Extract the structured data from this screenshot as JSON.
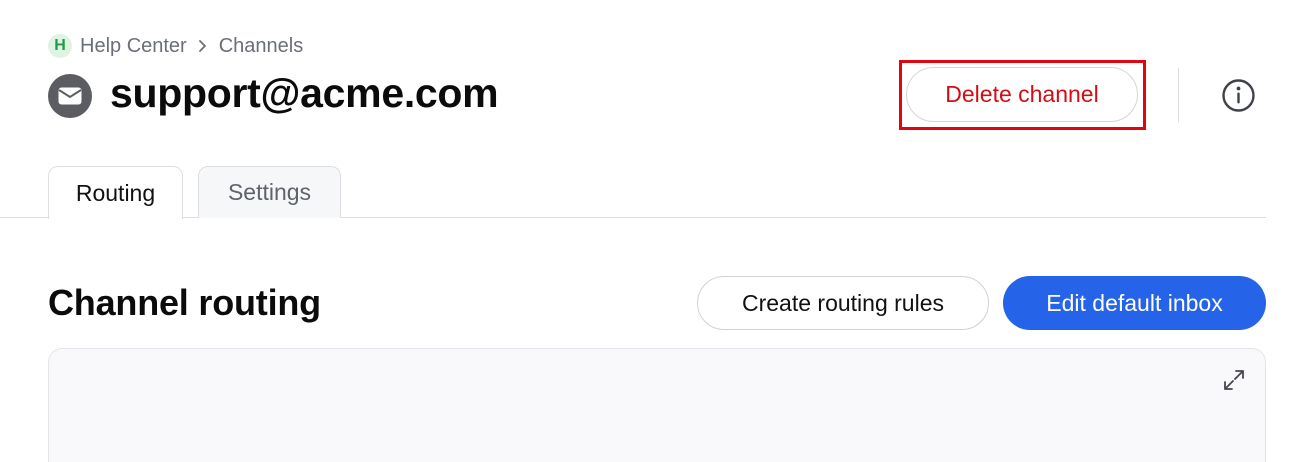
{
  "breadcrumb": {
    "logo_letter": "H",
    "items": [
      "Help Center",
      "Channels"
    ]
  },
  "header": {
    "title": "support@acme.com",
    "avatar_icon": "envelope-icon",
    "delete_label": "Delete channel",
    "info_icon": "info-icon"
  },
  "tabs": [
    {
      "label": "Routing",
      "active": true
    },
    {
      "label": "Settings",
      "active": false
    }
  ],
  "section": {
    "title": "Channel routing",
    "create_rules_label": "Create routing rules",
    "edit_inbox_label": "Edit default inbox",
    "expand_icon": "expand-icon"
  },
  "colors": {
    "accent": "#2563e8",
    "danger": "#d40d14",
    "highlight": "#e0060f",
    "logo_green": "#1f9d46"
  }
}
